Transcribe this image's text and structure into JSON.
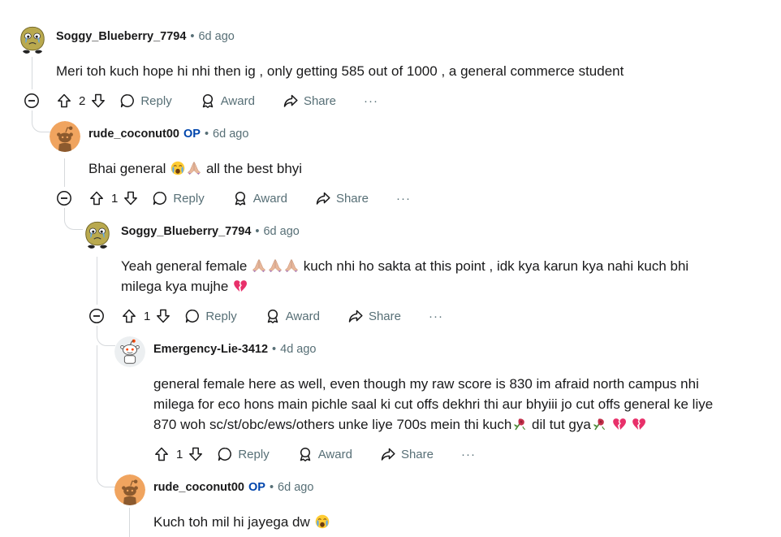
{
  "comments": [
    {
      "author": "Soggy_Blueberry_7794",
      "is_op": false,
      "time": "6d ago",
      "body": "Meri toh kuch hope hi nhi then ig , only getting 585 out of 1000 , a general commerce student",
      "votes": "2",
      "avatar": "green-blob-avatar"
    },
    {
      "author": "rude_coconut00",
      "is_op": true,
      "op_label": "OP",
      "time": "6d ago",
      "body_before": "Bhai general",
      "body_after": "all the best bhyi",
      "votes": "1",
      "avatar": "default-snoo-avatar"
    },
    {
      "author": "Soggy_Blueberry_7794",
      "is_op": false,
      "time": "6d ago",
      "body_line1_before": "Yeah general female",
      "body_line1_after": "kuch nhi ho sakta at this point , idk kya karun kya nahi kuch bhi",
      "body_line2": "milega kya mujhe",
      "votes": "1",
      "avatar": "green-blob-avatar"
    },
    {
      "author": "Emergency-Lie-3412",
      "is_op": false,
      "time": "4d ago",
      "body_line1": "general female here as well, even though my raw score is 830 im afraid north campus nhi",
      "body_line2": "milega for eco hons main pichle saal ki cut offs dekhri thi aur bhyiii jo cut offs general ke liye",
      "body_line3_before": "870 woh sc/st/obc/ews/others unke liye 700s mein thi kuch",
      "body_line3_mid": "dil tut gya",
      "votes": "1",
      "avatar": "snoo-robot-avatar"
    },
    {
      "author": "rude_coconut00",
      "is_op": true,
      "op_label": "OP",
      "time": "6d ago",
      "body": "Kuch toh mil hi jayega dw",
      "avatar": "default-snoo-avatar"
    }
  ],
  "actions": {
    "reply": "Reply",
    "award": "Award",
    "share": "Share",
    "more": "···"
  },
  "colors": {
    "op": "#0045ac",
    "meta": "#576f76",
    "thread_line": "#d6d9dc",
    "default_avatar_bg": "#f0a45f"
  },
  "emoji_names": [
    "crying-face",
    "folded-hands",
    "broken-heart",
    "wilted-rose"
  ]
}
